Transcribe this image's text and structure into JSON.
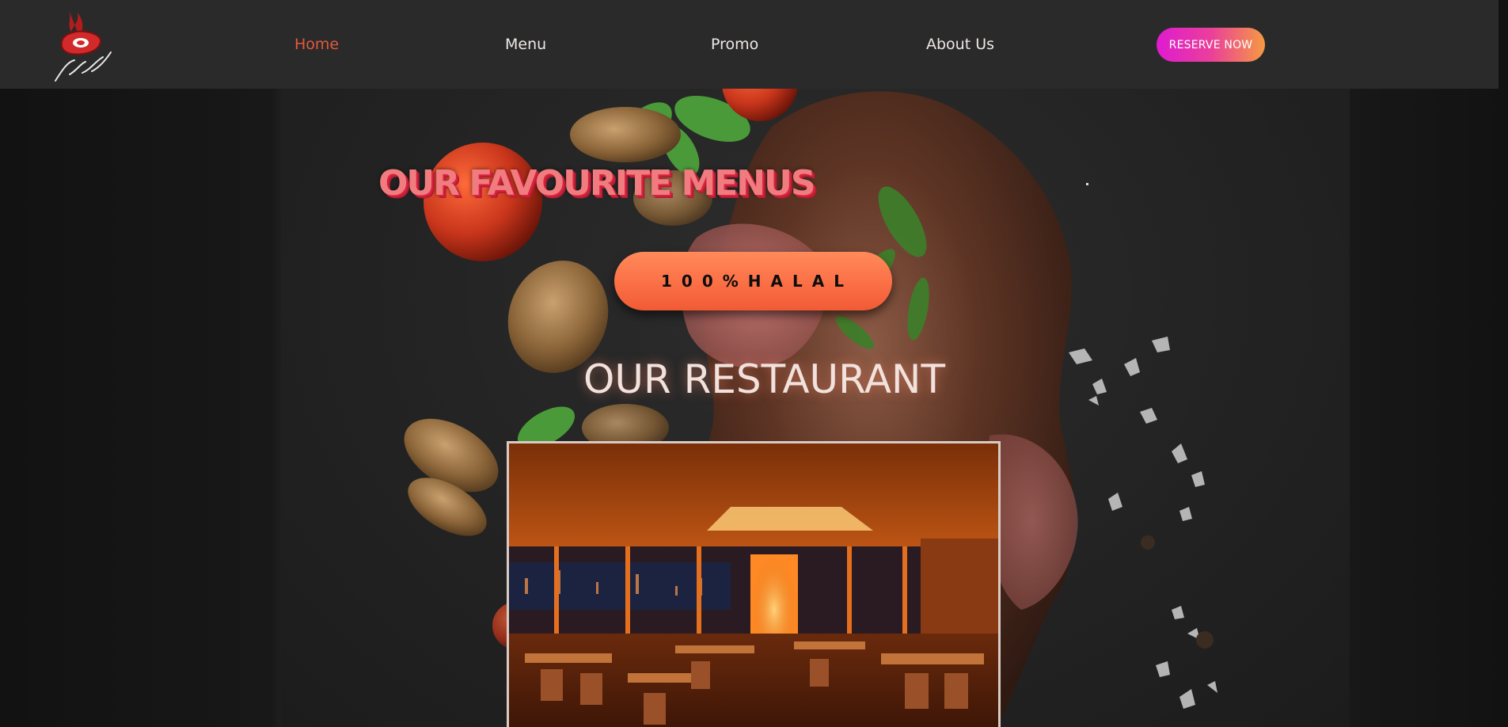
{
  "brand": {
    "logo_alt": "Abdul Steak",
    "logo_icon": "steak-flame-logo"
  },
  "nav": {
    "items": [
      {
        "label": "Home",
        "active": true
      },
      {
        "label": "Menu",
        "active": false
      },
      {
        "label": "Promo",
        "active": false
      },
      {
        "label": "About Us",
        "active": false
      }
    ],
    "reserve_label": "RESERVE NOW"
  },
  "hero": {
    "favourite_title": "OUR FAVOURITE MENUS",
    "halal_label": "100%HALAL",
    "restaurant_title": "OUR RESTAURANT",
    "photo_subject": "restaurant-interior-photo"
  },
  "colors": {
    "accent_orange": "#e2593c",
    "header_bg": "#2b2a2a",
    "reserve_gradient_start": "#df1bd0",
    "reserve_gradient_end": "#f59a42",
    "halal_orange": "#fb6f45",
    "title_pink": "#f07c7f"
  }
}
